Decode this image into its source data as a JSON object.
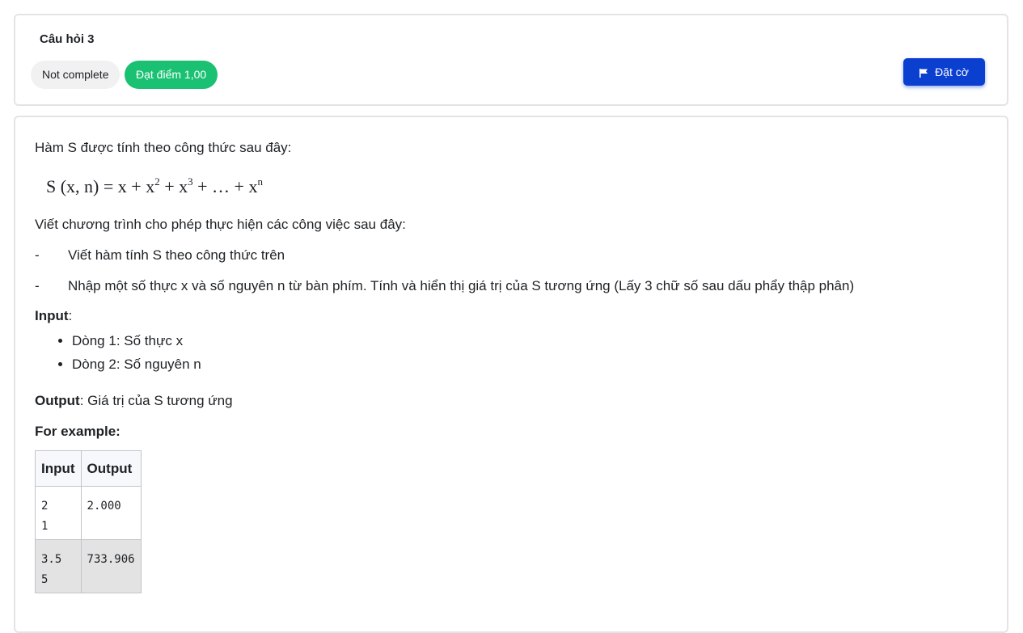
{
  "question": {
    "title": "Câu hỏi 3",
    "state": "Not complete",
    "grade": "Đạt điểm 1,00",
    "flag_label": "Đặt cờ"
  },
  "content": {
    "intro": "Hàm S được tính theo công thức sau đây:",
    "formula": {
      "lhs": "S (x, n) = x + x",
      "exp2": "2",
      "mid1": " + x",
      "exp3": "3",
      "mid2": " + … + x",
      "expn": "n"
    },
    "task_intro": "Viết chương trình cho phép thực hiện các công việc sau đây:",
    "tasks": [
      {
        "bullet": "-",
        "text": "Viết hàm tính S theo công thức trên"
      },
      {
        "bullet": "-",
        "text": "Nhập một số thực x và số nguyên n từ bàn phím. Tính và hiển thị giá trị của S tương ứng (Lấy 3 chữ số sau dấu phẩy thập phân)"
      }
    ],
    "input_label": "Input",
    "input_colon": ":",
    "input_items": [
      "Dòng 1: Số thực x",
      "Dòng 2: Số nguyên n"
    ],
    "output_label": "Output",
    "output_text": ": Giá trị của S tương ứng",
    "example_label": "For example:",
    "table": {
      "headers": [
        "Input",
        "Output"
      ],
      "rows": [
        {
          "input_line1": "2",
          "input_line2": "1",
          "output": "2.000"
        },
        {
          "input_line1": "3.5",
          "input_line2": "5",
          "output": "733.906"
        }
      ]
    }
  },
  "colors": {
    "flag_button": "#0b3fd0",
    "grade_badge": "#1ac173"
  }
}
